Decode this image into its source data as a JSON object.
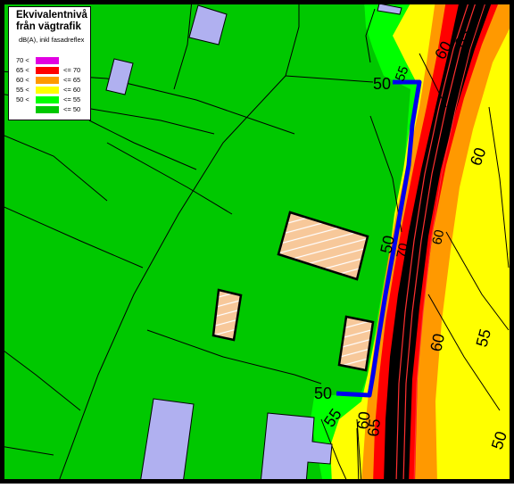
{
  "legend": {
    "title_line1": "Ekvivalentnivå",
    "title_line2": "från vägtrafik",
    "subtitle": "dB(A), inkl fasadreflex",
    "classes": [
      {
        "lower": "70 <",
        "upper": "",
        "color": "#e100e1"
      },
      {
        "lower": "65 <",
        "upper": "<= 70",
        "color": "#ff0000"
      },
      {
        "lower": "60 <",
        "upper": "<= 65",
        "color": "#ff9900"
      },
      {
        "lower": "55 <",
        "upper": "<= 60",
        "color": "#ffff00"
      },
      {
        "lower": "50 <",
        "upper": "<= 55",
        "color": "#00ff00"
      },
      {
        "lower": "",
        "upper": "<= 50",
        "color": "#00c800"
      }
    ]
  },
  "contour_labels": {
    "l50_top": "50",
    "l50_mid": "50",
    "l50_bottom": "50",
    "l55_top": "55",
    "l55_bottom": "55",
    "l55_right": "55",
    "l60_top": "60",
    "l60_right_mid": "60",
    "l60_lower": "60",
    "l60_bottom": "60",
    "l65_top": "65",
    "l65_bottom": "65",
    "l70_mid": "70",
    "l50_far_right": "50",
    "l42_edge": "42"
  },
  "colors": {
    "below50": "#00c800",
    "db50_55": "#00ff00",
    "db55_60": "#ffff00",
    "db60_65": "#ff9900",
    "db65_70": "#ff0000",
    "road": "#000000",
    "building_existing": "#b0b0f0",
    "building_planned": "#f7c89a",
    "boundary_line": "#0000ff"
  }
}
